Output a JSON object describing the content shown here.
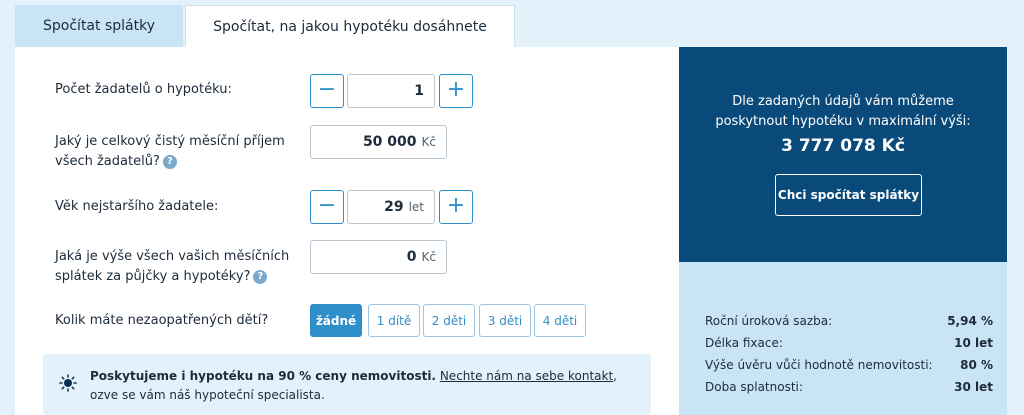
{
  "tabs": [
    {
      "label": "Spočítat splátky",
      "active": false
    },
    {
      "label": "Spočítat, na jakou hypotéku dosáhnete",
      "active": true
    }
  ],
  "form": {
    "applicants": {
      "label": "Počet žadatelů o hypotéku:",
      "value": "1",
      "minus": "−",
      "plus": "+"
    },
    "income": {
      "label_line1": "Jaký je celkový čistý měsíční příjem",
      "label_line2": "všech žadatelů?",
      "value": "50 000",
      "unit": "Kč",
      "help": "?"
    },
    "age": {
      "label": "Věk nejstaršího žadatele:",
      "value": "29",
      "unit": "let",
      "minus": "−",
      "plus": "+"
    },
    "payments": {
      "label_line1": "Jaká je výše všech vašich měsíčních",
      "label_line2": "splátek za půjčky a hypotéky?",
      "value": "0",
      "unit": "Kč",
      "help": "?"
    },
    "children": {
      "label": "Kolik máte nezaopatřených dětí?",
      "options": [
        "žádné",
        "1 dítě",
        "2 děti",
        "3 děti",
        "4 děti"
      ],
      "selected_index": 0
    }
  },
  "info": {
    "bold": "Poskytujeme i hypotéku na 90 % ceny nemovitosti.",
    "link": "Nechte nám na sebe kontakt",
    "rest": ", ozve se vám náš hypoteční specialista."
  },
  "result": {
    "text_line1": "Dle zadaných údajů vám můžeme",
    "text_line2": "poskytnout hypotéku v maximální výši:",
    "amount": "3 777 078 Kč",
    "button": "Chci spočítat splátky"
  },
  "params": [
    {
      "label": "Roční úroková sazba:",
      "value": "5,94 %"
    },
    {
      "label": "Délka fixace:",
      "value": "10 let"
    },
    {
      "label": "Výše úvěru vůči hodnotě nemovitosti:",
      "value": "80 %"
    },
    {
      "label": "Doba splatnosti:",
      "value": "30 let"
    }
  ],
  "colors": {
    "primary": "#2f8fc9",
    "dark_panel": "#0a4a7a",
    "light_panel": "#c9e4f5",
    "background": "#e3f1fb"
  }
}
